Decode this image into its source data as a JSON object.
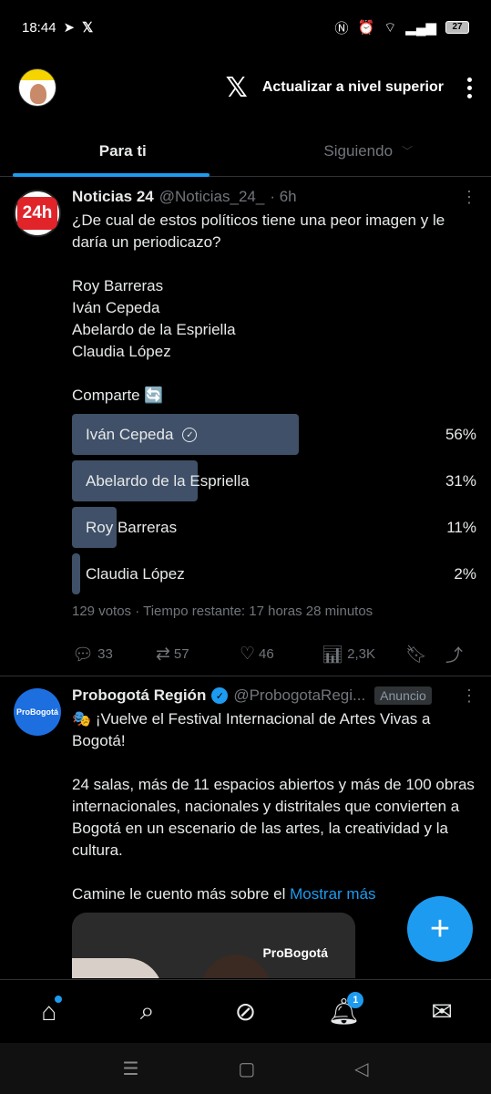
{
  "status": {
    "time": "18:44",
    "battery": "27"
  },
  "header": {
    "upgrade_label": "Actualizar a nivel superior"
  },
  "tabs": [
    {
      "label": "Para ti"
    },
    {
      "label": "Siguiendo"
    }
  ],
  "tweet1": {
    "name": "Noticias 24",
    "handle": "@Noticias_24_",
    "time": "· 6h",
    "avatar_text": "24h",
    "lines": [
      "¿De cual de estos políticos tiene una peor imagen y le daría un periodicazo?",
      "",
      "Roy Barreras",
      "Iván Cepeda",
      "Abelardo de la Espriella",
      "Claudia López",
      "",
      "Comparte 🔄"
    ],
    "poll": [
      {
        "label": "Iván Cepeda",
        "percent": "56%",
        "value": 0.56
      },
      {
        "label": "Abelardo de la Espriella",
        "percent": "31%",
        "value": 0.31
      },
      {
        "label": "Roy Barreras",
        "percent": "11%",
        "value": 0.11
      },
      {
        "label": "Claudia López",
        "percent": "2%",
        "value": 0.02
      }
    ],
    "poll_meta": "129 votos · Tiempo restante: 17 horas 28 minutos",
    "stats": {
      "replies": "33",
      "reposts": "57",
      "likes": "46",
      "views": "2,3K"
    }
  },
  "tweet2": {
    "name": "Probogotá Región",
    "handle": "@ProbogotaRegi...",
    "ad_label": "Anuncio",
    "avatar_text": "ProBogotá",
    "lines": [
      "🎭 ¡Vuelve el Festival Internacional de Artes Vivas a Bogotá!",
      "",
      "24 salas, más de 11 espacios abiertos y más de 100 obras internacionales, nacionales y distritales que convierten a Bogotá en un escenario de las artes, la creatividad y la cultura.",
      ""
    ],
    "last_line": "Camine le cuento más sobre el",
    "show_more": "Mostrar más",
    "media_watermark": "ProBogotá"
  },
  "nav": {
    "notifications_badge": "1"
  }
}
